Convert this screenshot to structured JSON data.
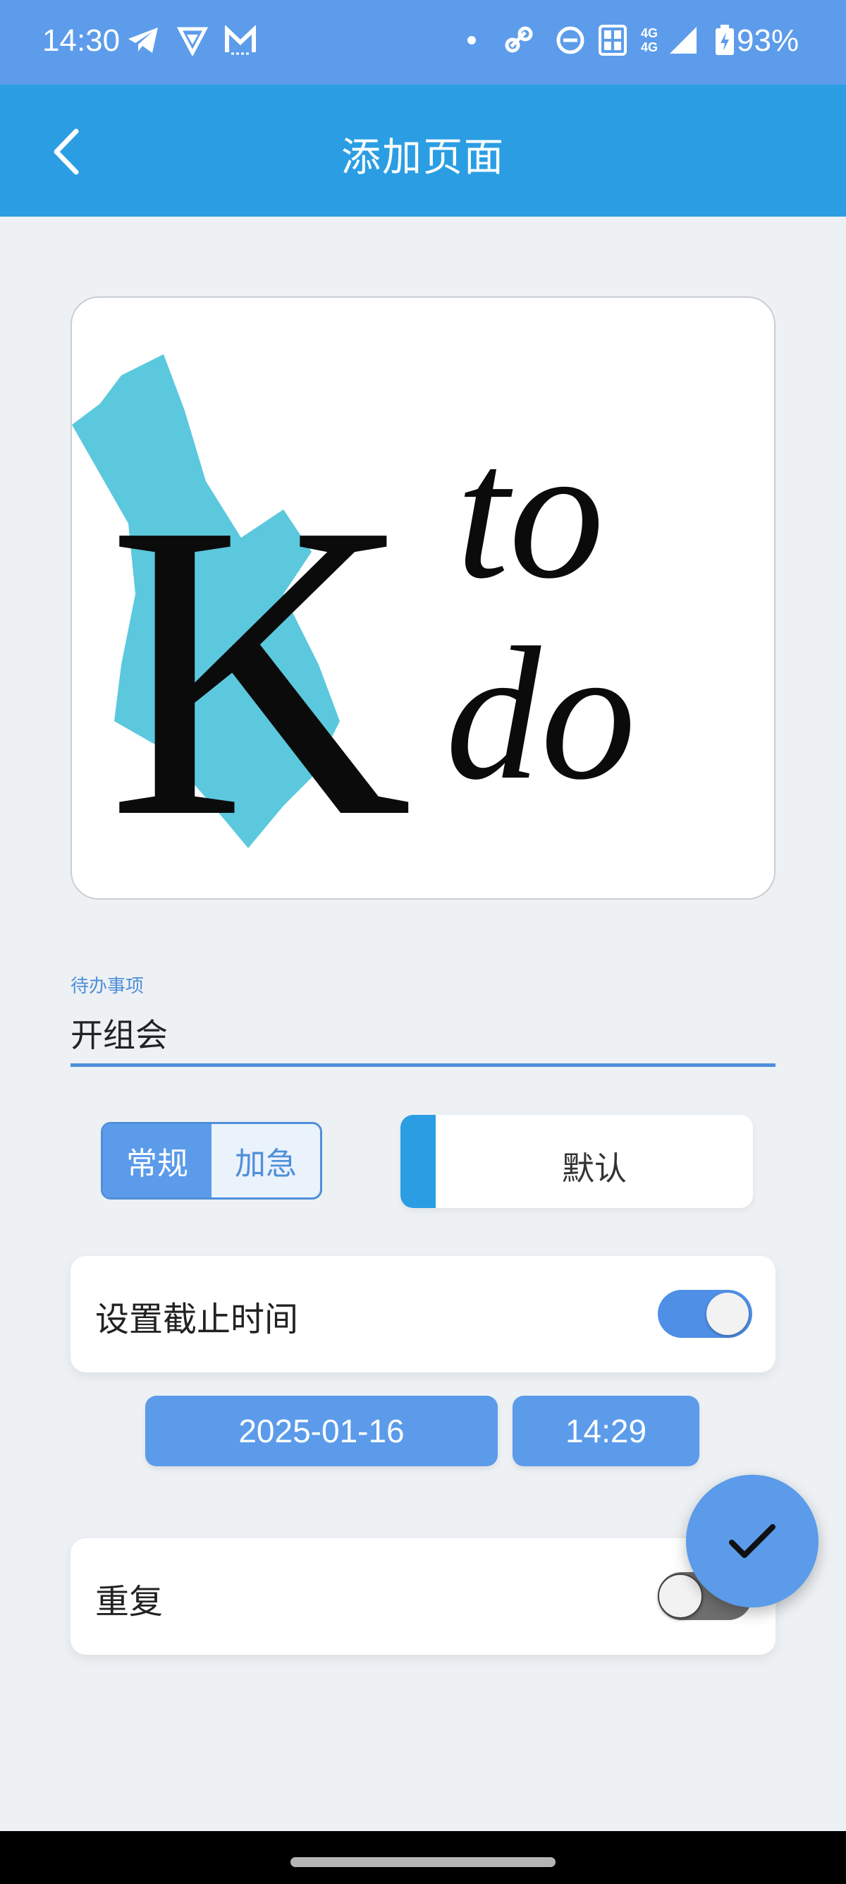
{
  "status_bar": {
    "time": "14:30",
    "battery": "93%",
    "icons": [
      "telegram-icon",
      "vpn-shield-icon",
      "mail-m-icon",
      "dot-icon",
      "link-icon",
      "do-not-disturb-icon",
      "nfc-icon",
      "network-4g-icon",
      "signal-icon",
      "battery-charging-icon"
    ],
    "network_label_top": "4G",
    "network_label_bottom": "4G",
    "color": "#5c9ceb"
  },
  "app_bar": {
    "title": "添加页面",
    "back_icon": "chevron-left-icon",
    "color": "#2b9ee3"
  },
  "logo": {
    "letter": "K",
    "line1": "to",
    "line2": "do",
    "accent_color": "#5bc8dd"
  },
  "todo_field": {
    "label": "待办事项",
    "value": "开组会"
  },
  "priority": {
    "options": [
      "常规",
      "加急"
    ],
    "selected": "常规"
  },
  "category": {
    "label": "默认",
    "color": "#2b9ee3"
  },
  "deadline": {
    "label": "设置截止时间",
    "enabled": true,
    "date": "2025-01-16",
    "time": "14:29"
  },
  "repeat": {
    "label": "重复",
    "enabled": false
  },
  "fab": {
    "icon": "check-icon"
  }
}
